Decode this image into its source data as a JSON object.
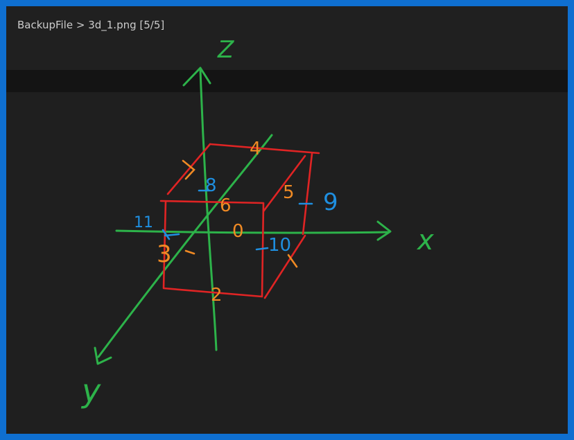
{
  "window": {
    "title": "BackupFile > 3d_1.png [5/5]"
  },
  "colors": {
    "border": "#0f6fd0",
    "axis": "#2db34a",
    "cube": "#e02424",
    "label_orange": "#f08a24",
    "label_blue": "#1f8fe0"
  },
  "drawing": {
    "axis_labels": {
      "z": "Z",
      "x": "x",
      "y": "y"
    },
    "vertex_labels": {
      "v0": "0",
      "v2": "2",
      "v3": "3",
      "v4": "4",
      "v5": "5",
      "v6": "6",
      "v8": "8",
      "v9": "9",
      "v10": "10",
      "v11": "11"
    }
  }
}
